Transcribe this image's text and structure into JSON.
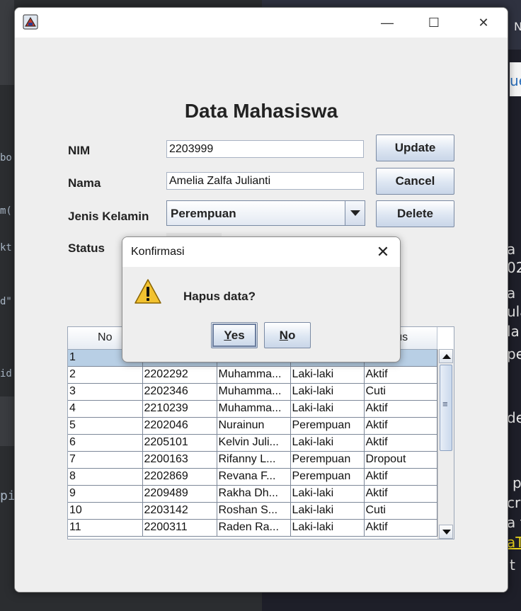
{
  "background": {
    "left_code": [
      "bo",
      "m(",
      "kt",
      "d\"",
      "id",
      "pi"
    ],
    "right_text": [
      "ue",
      "N",
      "a",
      "02",
      "a",
      "ula",
      "la",
      "pe",
      "de",
      "p",
      "cr",
      "a t",
      "aT",
      "t"
    ]
  },
  "window": {
    "title": "",
    "controls": {
      "minimize": "—",
      "maximize": "☐",
      "close": "✕"
    }
  },
  "form": {
    "heading": "Data Mahasiswa",
    "nim_label": "NIM",
    "nim_value": "2203999",
    "nama_label": "Nama",
    "nama_value": "Amelia Zalfa Julianti",
    "jk_label": "Jenis Kelamin",
    "jk_value": "Perempuan",
    "status_label": "Status",
    "update_label": "Update",
    "cancel_label": "Cancel",
    "delete_label": "Delete"
  },
  "table": {
    "columns": [
      "No",
      "",
      "",
      "",
      "tus"
    ],
    "rows": [
      [
        "1",
        "",
        "",
        "",
        ""
      ],
      [
        "2",
        "2202292",
        "Muhamma...",
        "Laki-laki",
        "Aktif"
      ],
      [
        "3",
        "2202346",
        "Muhamma...",
        "Laki-laki",
        "Cuti"
      ],
      [
        "4",
        "2210239",
        "Muhamma...",
        "Laki-laki",
        "Aktif"
      ],
      [
        "5",
        "2202046",
        "Nurainun",
        "Perempuan",
        "Aktif"
      ],
      [
        "6",
        "2205101",
        "Kelvin Juli...",
        "Laki-laki",
        "Aktif"
      ],
      [
        "7",
        "2200163",
        "Rifanny L...",
        "Perempuan",
        "Dropout"
      ],
      [
        "8",
        "2202869",
        "Revana F...",
        "Perempuan",
        "Aktif"
      ],
      [
        "9",
        "2209489",
        "Rakha Dh...",
        "Laki-laki",
        "Aktif"
      ],
      [
        "10",
        "2203142",
        "Roshan S...",
        "Laki-laki",
        "Cuti"
      ],
      [
        "11",
        "2200311",
        "Raden Ra...",
        "Laki-laki",
        "Aktif"
      ]
    ]
  },
  "dialog": {
    "title": "Konfirmasi",
    "message": "Hapus data?",
    "close": "✕",
    "yes_mnemonic": "Y",
    "yes_rest": "es",
    "no_mnemonic": "N",
    "no_rest": "o"
  },
  "colors": {
    "selected_row": "#b8cfe5",
    "button_border": "#7a8aa3",
    "warning": "#f2c230"
  }
}
